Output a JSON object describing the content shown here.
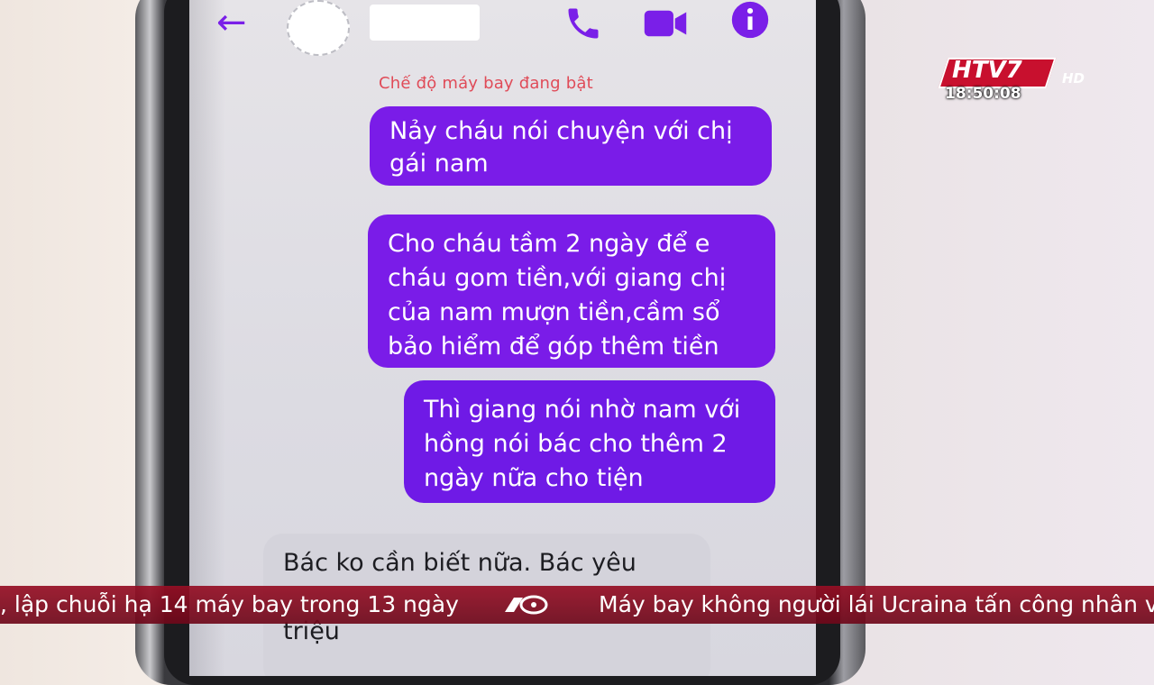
{
  "header": {
    "back_icon": "arrow-left-icon",
    "call_icon": "phone-icon",
    "video_icon": "video-camera-icon",
    "info_icon": "info-icon",
    "accent_color": "#7a1fe8"
  },
  "notice": "Chế độ máy bay đang bật",
  "messages": [
    {
      "direction": "sent",
      "text": "Nảy cháu nói chuyện với chị\ngái nam"
    },
    {
      "direction": "sent",
      "text": "Cho cháu tầm 2 ngày để e\ncháu gom tiền,với giang chị\ncủa nam mượn tiền,cầm sổ\nbảo hiểm để góp thêm tiền"
    },
    {
      "direction": "sent",
      "text": "Thì giang nói nhờ nam với\nhồng nói bác cho thêm 2\nngày nữa cho tiện"
    },
    {
      "direction": "received",
      "text": "Bác ko cần biết nữa. Bác yêu\n\ntriệu"
    }
  ],
  "overlay": {
    "channel_logo": "HTV7",
    "channel_hd": "HD",
    "clock": "18:50:08"
  },
  "ticker": {
    "left": ", lập chuỗi hạ 14 máy bay trong 13 ngày",
    "right": "Máy bay không người lái Ucraina tấn công nhân v",
    "brand_icon": "60-news-logo-icon",
    "color": "#960e24"
  }
}
